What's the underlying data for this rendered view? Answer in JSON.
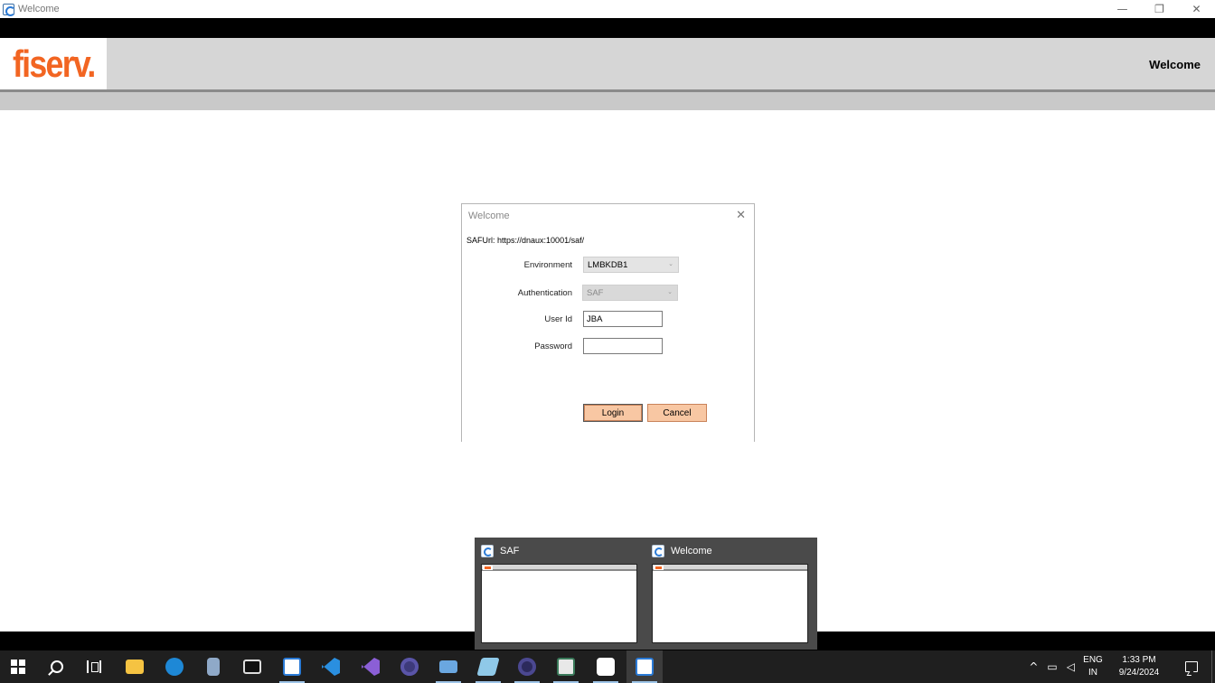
{
  "window": {
    "title": "Welcome",
    "minimize": "—",
    "restore": "❐",
    "close": "✕"
  },
  "header": {
    "logo": "fiserv.",
    "welcome": "Welcome"
  },
  "dialog": {
    "title": "Welcome",
    "close": "✕",
    "saf_url_label": "SAFUrl:",
    "saf_url_value": "https://dnaux:10001/saf/",
    "environment_label": "Environment",
    "environment_value": "LMBKDB1",
    "authentication_label": "Authentication",
    "authentication_value": "SAF",
    "userid_label": "User Id",
    "userid_value": "JBA",
    "password_label": "Password",
    "password_value": "",
    "login_label": "Login",
    "cancel_label": "Cancel"
  },
  "preview": {
    "items": [
      {
        "title": "SAF"
      },
      {
        "title": "Welcome"
      }
    ]
  },
  "taskbar": {
    "colors": {
      "explorer": "#f5c342",
      "edge": "#1e88d6",
      "vscode": "#2a8fe0",
      "vs": "#8b5fd6",
      "eclipse": "#3d3a7a",
      "cmd": "#2b2b2b",
      "app": "#2a7ad6"
    },
    "tray": {
      "chevron": "^",
      "lang_top": "ENG",
      "lang_bottom": "IN",
      "time": "1:33 PM",
      "date": "9/24/2024"
    }
  }
}
